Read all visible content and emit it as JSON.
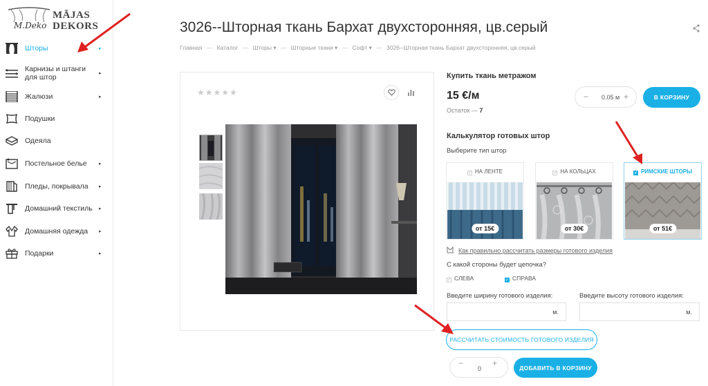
{
  "logo": {
    "script": "M.Deko",
    "line1": "MĀJAS",
    "line2": "DEKORS"
  },
  "sidebar": {
    "items": [
      {
        "label": "Шторы",
        "active": true,
        "chevron": "▸"
      },
      {
        "label": "Карнизы и штанги для штор",
        "active": false,
        "chevron": "▸"
      },
      {
        "label": "Жалюзи",
        "active": false,
        "chevron": "▸"
      },
      {
        "label": "Подушки",
        "active": false,
        "chevron": ""
      },
      {
        "label": "Одеяла",
        "active": false,
        "chevron": ""
      },
      {
        "label": "Постельное белье",
        "active": false,
        "chevron": "▸"
      },
      {
        "label": "Пледы, покрывала",
        "active": false,
        "chevron": "▸"
      },
      {
        "label": "Домашний текстиль",
        "active": false,
        "chevron": "▸"
      },
      {
        "label": "Домашняя одежда",
        "active": false,
        "chevron": "▸"
      },
      {
        "label": "Подарки",
        "active": false,
        "chevron": "▸"
      }
    ]
  },
  "page": {
    "title": "3026--Шторная ткань Бархат двухсторонняя, цв.серый",
    "breadcrumb": [
      "Главная",
      "Каталог",
      "Шторы ▾",
      "Шторные ткани ▾",
      "Софт ▾",
      "3026--Шторная ткань Бархат двухсторонняя, цв.серый"
    ],
    "breadcrumb_sep": "—"
  },
  "gallery": {
    "stars": "★★★★★"
  },
  "buy": {
    "heading": "Купить ткань метражом",
    "price": "15 €/м",
    "stock_label": "Остаток —",
    "stock_value": "7",
    "qty_minus": "−",
    "qty_value": "0.05 м",
    "qty_plus": "+",
    "cart_button": "В КОРЗИНУ"
  },
  "calculator": {
    "heading": "Калькулятор готовых штор",
    "choose_type": "Выберите тип штор",
    "types": [
      {
        "label": "НА ЛЕНТЕ",
        "price": "от 15€",
        "selected": false
      },
      {
        "label": "НА КОЛЬЦАХ",
        "price": "от 30€",
        "selected": false
      },
      {
        "label": "РИМСКИЕ ШТОРЫ",
        "price": "от 51€",
        "selected": true
      }
    ],
    "howto_link": "Как правильно рассчитать размеры готового изделия",
    "chain_question": "С какой стороны будет цепочка?",
    "sides": [
      {
        "label": "СЛЕВА",
        "checked": false
      },
      {
        "label": "СПРАВА",
        "checked": true
      }
    ],
    "width_label": "Введите ширину готового изделия:",
    "height_label": "Введите высоту готового изделия:",
    "unit": "м.",
    "calc_button": "РАССЧИТАТЬ СТОИМОСТЬ ГОТОВОГО ИЗДЕЛИЯ",
    "qty_minus": "−",
    "qty_value": "0",
    "qty_plus": "+",
    "add_button": "ДОБАВИТЬ В КОРЗИНУ"
  },
  "colors": {
    "accent": "#1ab0e6",
    "annotation": "#e02020"
  }
}
